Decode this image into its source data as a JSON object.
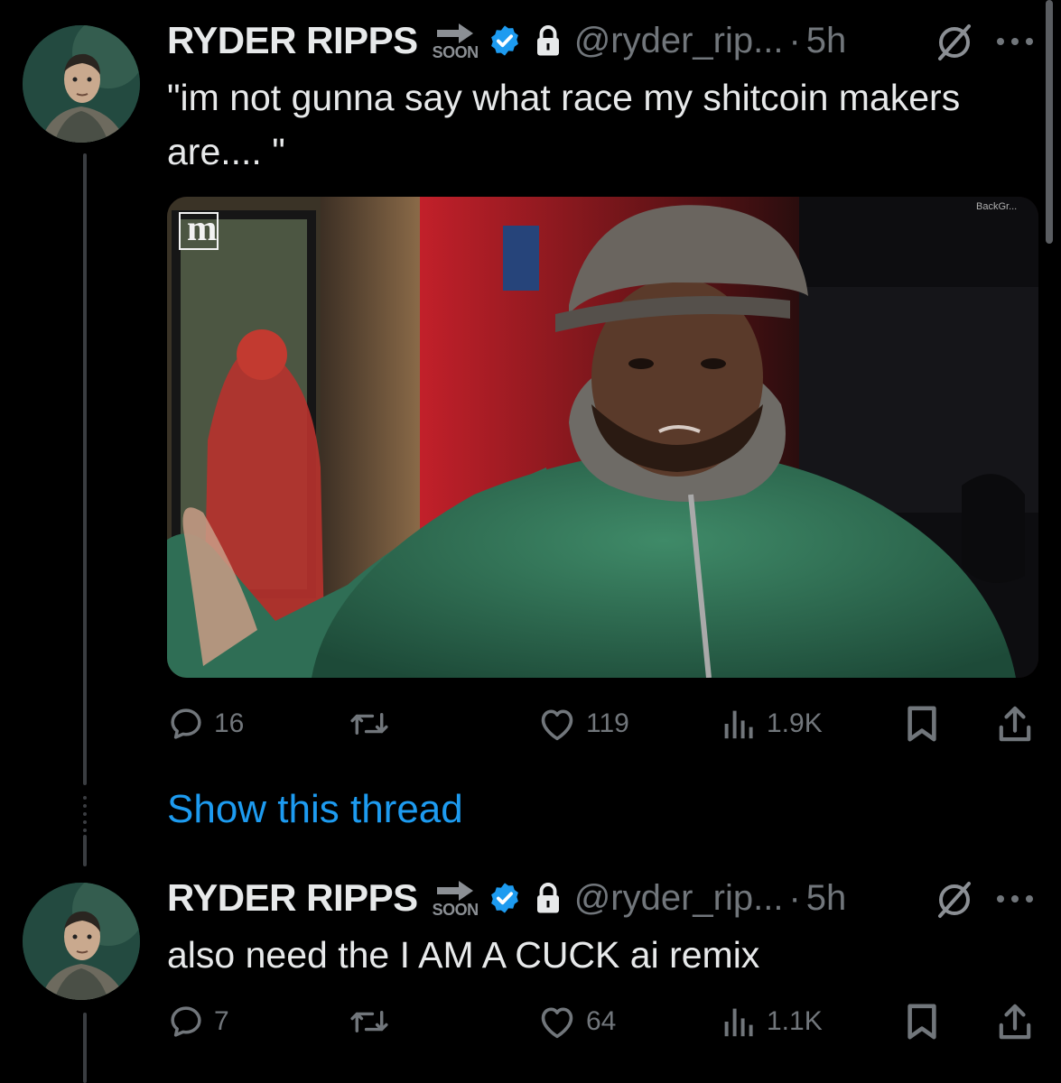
{
  "tweets": [
    {
      "author_name": "RYDER RIPPS",
      "badge_label": "SOON",
      "handle": "@ryder_rip...",
      "separator": "·",
      "time": "5h",
      "text": "\"im not gunna say what race my shitcoin makers are.... \"",
      "media": {
        "watermark": "m",
        "corner_text": "BackGr..."
      },
      "replies": "16",
      "retweets": "",
      "likes": "119",
      "views": "1.9K"
    },
    {
      "author_name": "RYDER RIPPS",
      "badge_label": "SOON",
      "handle": "@ryder_rip...",
      "separator": "·",
      "time": "5h",
      "text": "also need the I AM A CUCK ai remix",
      "replies": "7",
      "retweets": "",
      "likes": "64",
      "views": "1.1K"
    }
  ],
  "show_thread_label": "Show this thread",
  "colors": {
    "background": "#000000",
    "text": "#e7e9ea",
    "muted": "#71767b",
    "accent": "#1d9bf0"
  },
  "icons": [
    "arrow-right-icon",
    "verified-badge-icon",
    "lock-icon",
    "grok-icon",
    "more-icon",
    "reply-icon",
    "retweet-icon",
    "like-icon",
    "views-icon",
    "bookmark-icon",
    "share-icon"
  ]
}
